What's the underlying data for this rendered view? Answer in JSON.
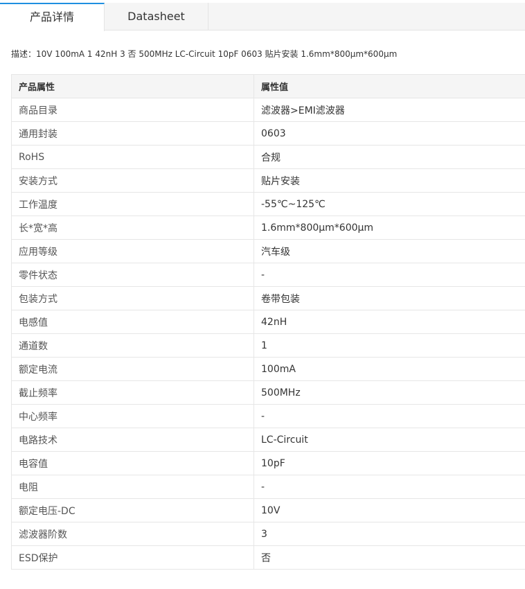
{
  "tabs": [
    {
      "label": "产品详情",
      "active": true
    },
    {
      "label": "Datasheet",
      "active": false
    }
  ],
  "description": {
    "label": "描述：",
    "text": "10V 100mA 1 42nH 3 否 500MHz LC-Circuit 10pF 0603 贴片安装 1.6mm*800μm*600μm"
  },
  "table": {
    "headers": [
      "产品属性",
      "属性值"
    ],
    "rows": [
      {
        "name": "商品目录",
        "value": "滤波器>EMI滤波器"
      },
      {
        "name": "通用封装",
        "value": "0603"
      },
      {
        "name": "RoHS",
        "value": "合规"
      },
      {
        "name": "安装方式",
        "value": "贴片安装"
      },
      {
        "name": "工作温度",
        "value": "-55℃~125℃"
      },
      {
        "name": "长*宽*高",
        "value": "1.6mm*800μm*600μm"
      },
      {
        "name": "应用等级",
        "value": "汽车级"
      },
      {
        "name": "零件状态",
        "value": "-"
      },
      {
        "name": "包装方式",
        "value": "卷带包装"
      },
      {
        "name": "电感值",
        "value": "42nH"
      },
      {
        "name": "通道数",
        "value": "1"
      },
      {
        "name": "额定电流",
        "value": "100mA"
      },
      {
        "name": "截止频率",
        "value": "500MHz"
      },
      {
        "name": "中心频率",
        "value": "-"
      },
      {
        "name": "电路技术",
        "value": "LC-Circuit"
      },
      {
        "name": "电容值",
        "value": "10pF"
      },
      {
        "name": "电阻",
        "value": "-"
      },
      {
        "name": "额定电压-DC",
        "value": "10V"
      },
      {
        "name": "滤波器阶数",
        "value": "3"
      },
      {
        "name": "ESD保护",
        "value": "否"
      }
    ]
  },
  "colors": {
    "accent": "#1f8fe0",
    "header_bg": "#f5f5f5",
    "border": "#e6e6e6"
  }
}
